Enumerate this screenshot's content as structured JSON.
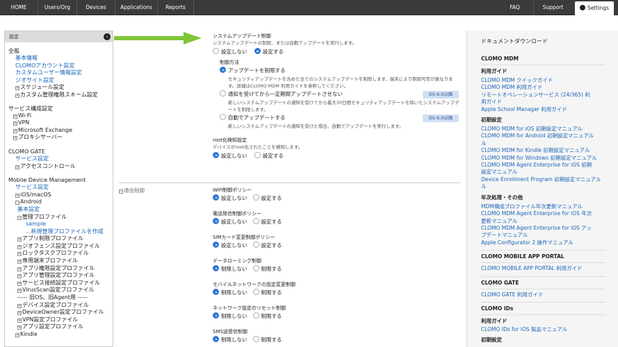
{
  "topnav": {
    "home": "HOME",
    "users": "Users/Org",
    "devices": "Devices",
    "applications": "Applications",
    "reports": "Reports",
    "faq": "FAQ",
    "support": "Support",
    "settings": "Settings"
  },
  "left": {
    "header": "設定",
    "general": {
      "title": "全般",
      "items": [
        "基本情報",
        "CLOMOアカウント設定",
        "カスタムユーザー情報設定",
        "ジオサイト設定"
      ],
      "sub": [
        "スケジュール設定",
        "カスタム管理権限スキーム設定"
      ]
    },
    "service": {
      "title": "サービス構成設定",
      "items": [
        "Wi-Fi",
        "VPN",
        "Microsoft Exchange",
        "プロキシサーバー"
      ]
    },
    "gate": {
      "title": "CLOMO GATE",
      "link": "サービス設定",
      "sub": "アクセスコントロール"
    },
    "mdm": {
      "title": "Mobile Device Management",
      "link": "サービス設定",
      "ios": "iOS/macOS",
      "android": "Android",
      "basic": "基本設定",
      "mgmt": "管理プロファイル",
      "sample": "sample",
      "create": "...新規管理プロファイルを作成",
      "profiles": [
        "アプリ制限プロファイル",
        "ジオフェンス設定プロファイル",
        "ロックタスクプロファイル",
        "専用端末プロファイル",
        "アプリ権限設定プロファイル",
        "アプリ管理設定プロファイル",
        "サービス接続設定プロファイル",
        "VirusScan設定プロファイル"
      ],
      "divider": "----- 旧OS、旧Agent用 -----",
      "legacy": [
        "デバイス設定プロファイル",
        "DeviceOwner設定プロファイル",
        "VPN設定プロファイル",
        "アプリ設定プロファイル"
      ],
      "kindle": "Kindle"
    }
  },
  "main": {
    "sysupdate": {
      "title": "システムアップデート制御",
      "desc": "システムアップデートの制限、または自動アップデートを実行します。",
      "opt_off": "設定しない",
      "opt_on": "設定する",
      "method_label": "制御方法",
      "m1": "アップデートを制限する",
      "m1_desc1": "セキュリティアップデートを含めた全てのシステムアップデートを制限します。端末により制限可否が異なりま",
      "m1_desc2": "す。詳細はCLOMO MDM 利用ガイドを参照してください。",
      "m2": "通知を受けてから一定期間アップデートさせない",
      "m2_desc1": "新しいシステムアップデートの通知を受けてから最大30日間セキュリティアップデートを除いたシステムアップデ",
      "m2_desc2": "ートを制限します。",
      "m3": "自動でアップデートする",
      "m3_desc": "新しいシステムアップデートの通知を受けた場合、自動でアップデートを実行します。",
      "badge": "OS 6.0以降"
    },
    "root": {
      "title": "root化検知設定",
      "desc": "デバイスがroot化されたことを検知します。",
      "opt_off": "設定しない",
      "opt_on": "設定する"
    },
    "comm_section": "通信制御",
    "wifi": {
      "title": "WiFi制御ポリシー",
      "opt_off": "設定しない",
      "opt_on": "設定する"
    },
    "phone": {
      "title": "電話発信制御ポリシー",
      "opt_off": "設定しない",
      "opt_on": "設定する"
    },
    "sim": {
      "title": "SIMカード変更制御ポリシー",
      "opt_off": "設定しない",
      "opt_on": "設定する"
    },
    "roaming": {
      "title": "データローミング制御",
      "opt_off": "制限しない",
      "opt_on": "制限する"
    },
    "mobile": {
      "title": "モバイルネットワークの設定変更制御",
      "opt_off": "制限しない",
      "opt_on": "制限する"
    },
    "netreset": {
      "title": "ネットワーク設定のリセット制御",
      "opt_off": "制限しない",
      "opt_on": "制限する"
    },
    "sms": {
      "title": "SMS送受信制御",
      "opt_off": "制限しない",
      "opt_on": "制限する"
    }
  },
  "right": {
    "title": "ドキュメントダウンロード",
    "mdm": {
      "head": "CLOMO MDM",
      "guide": "利用ガイド",
      "guide_links": [
        "CLOMO MDM クイックガイド",
        "CLOMO MDM 利用ガイド",
        "リモートオペレーションサービス (24/365) 利",
        "用ガイド",
        "Apple School Manager 利用ガイド"
      ],
      "init": "初期設定",
      "init_links": [
        "CLOMO MDM for iOS 初期設定マニュアル",
        "CLOMO MDM for Android 初期設定マニュアル",
        "ル",
        "CLOMO MDM for Kindle 初期設定マニュアル",
        "CLOMO MDM for Windows 初期設定マニュアル",
        "CLOMO MDM Agent Enterprise for iOS 初期",
        "設定マニュアル",
        "Device Enrollment Program 初期設定マニュアル",
        "ル"
      ],
      "yearly": "年次処理・その他",
      "yearly_links": [
        "MDM構成プロファイル年次更新マニュアル",
        "CLOMO MDM Agent Enterprise for iOS 年次",
        "更新マニュアル",
        "CLOMO MDM Agent Enterprise for iOS アッ",
        "プデートマニュアル",
        "Apple Configurator 2 操作マニュアル"
      ]
    },
    "portal": {
      "head": "CLOMO MOBILE APP PORTAL",
      "link": "CLOMO MOBILE APP PORTAL 利用ガイド"
    },
    "gate": {
      "head": "CLOMO GATE",
      "link": "CLOMO GATE 利用ガイド"
    },
    "ids": {
      "head": "CLOMO IDs",
      "guide": "利用ガイド",
      "link": "CLOMO IDs for iOS 製品マニュアル",
      "init": "初期設定"
    }
  },
  "colors": {
    "accent": "#2e7ad6",
    "link": "#1b64b7",
    "arrow": "#7fc63a",
    "topbar": "#3b3b3b"
  }
}
